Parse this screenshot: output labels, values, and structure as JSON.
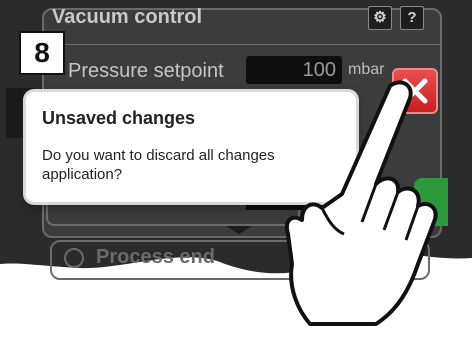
{
  "step_number": "8",
  "panel": {
    "title": "Vacuum control",
    "settings_icon": "gear-icon",
    "help_label": "?",
    "pressure_label": "Pressure setpoint",
    "pressure_value": "100",
    "pressure_unit": "mbar"
  },
  "bottom_section": {
    "title": "Process end",
    "icon": "circle-icon"
  },
  "dialog": {
    "title": "Unsaved changes",
    "message": "Do you want to discard all changes application?",
    "close_icon": "close-icon"
  },
  "colors": {
    "screen_bg": "#2b2b2b",
    "close_red": "#d92d2d",
    "ok_green": "#2c9a3c"
  },
  "overlay": {
    "hand": "hand-pointer-icon"
  }
}
